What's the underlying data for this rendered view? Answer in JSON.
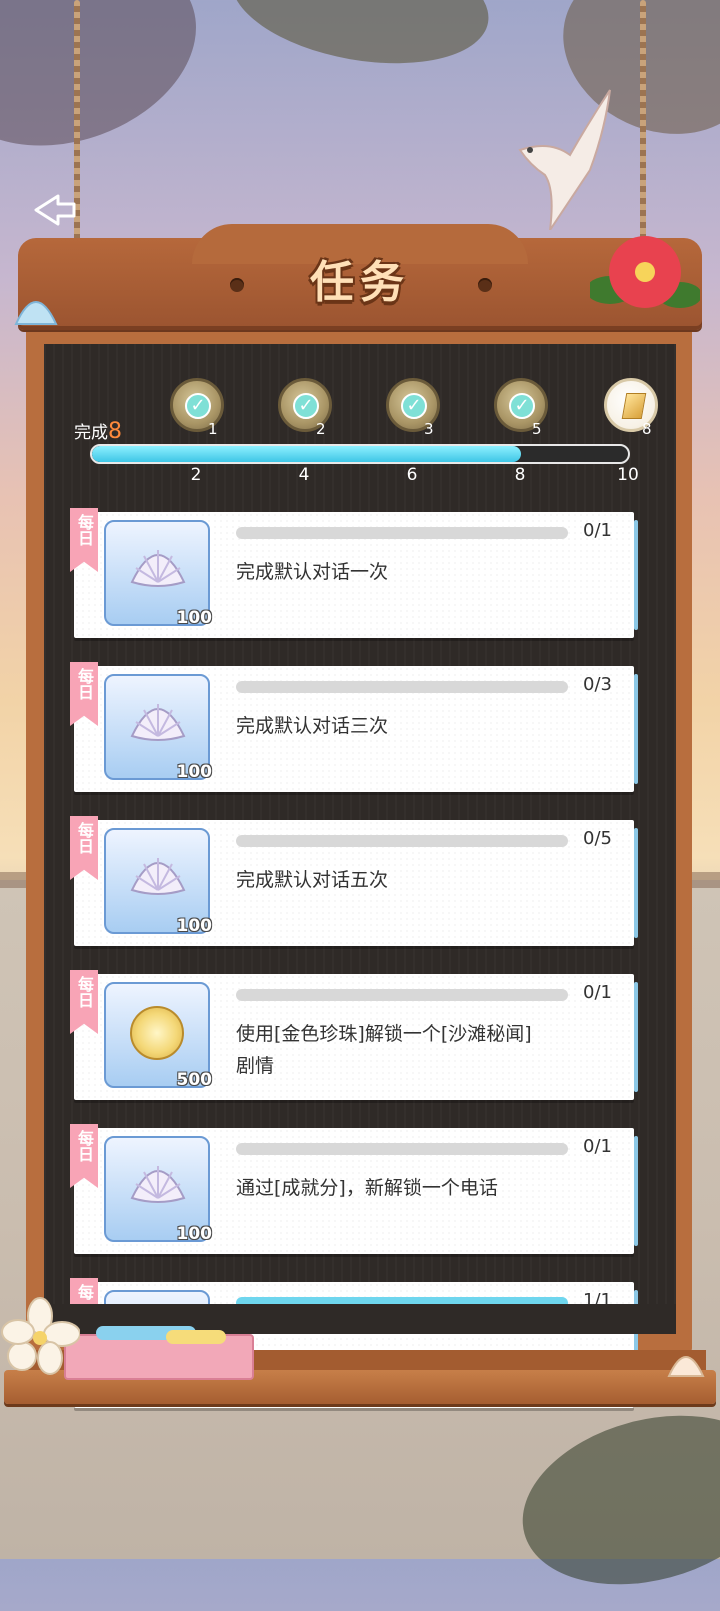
{
  "header": {
    "title": "任务"
  },
  "progress": {
    "done_label": "完成",
    "done_value": "8",
    "fill_fraction": 0.8,
    "ticks": [
      "2",
      "4",
      "6",
      "8",
      "10"
    ],
    "milestones": [
      {
        "count": "1",
        "state": "claimed"
      },
      {
        "count": "2",
        "state": "claimed"
      },
      {
        "count": "3",
        "state": "claimed"
      },
      {
        "count": "5",
        "state": "claimed"
      },
      {
        "count": "8",
        "state": "available"
      }
    ]
  },
  "tasks": [
    {
      "tag": "每日",
      "reward_icon": "shell-icon",
      "reward_qty": "100",
      "progress": "0/1",
      "fill": 0,
      "desc": "完成默认对话一次"
    },
    {
      "tag": "每日",
      "reward_icon": "shell-icon",
      "reward_qty": "100",
      "progress": "0/3",
      "fill": 0,
      "desc": "完成默认对话三次"
    },
    {
      "tag": "每日",
      "reward_icon": "shell-icon",
      "reward_qty": "100",
      "progress": "0/5",
      "fill": 0,
      "desc": "完成默认对话五次"
    },
    {
      "tag": "每日",
      "reward_icon": "coin-icon",
      "reward_qty": "500",
      "progress": "0/1",
      "fill": 0,
      "desc": "使用[金色珍珠]解锁一个[沙滩秘闻]剧情"
    },
    {
      "tag": "每日",
      "reward_icon": "shell-icon",
      "reward_qty": "100",
      "progress": "0/1",
      "fill": 0,
      "desc": "通过[成就分]，新解锁一个电话"
    },
    {
      "tag": "每",
      "reward_icon": "shell-icon",
      "reward_qty": "",
      "progress": "1/1",
      "fill": 1,
      "desc": ""
    }
  ],
  "colors": {
    "accent": "#ff8a3c",
    "bar_fill": "#3fc6e6",
    "ribbon": "#f8a4b6",
    "wood": "#b86e3e"
  }
}
